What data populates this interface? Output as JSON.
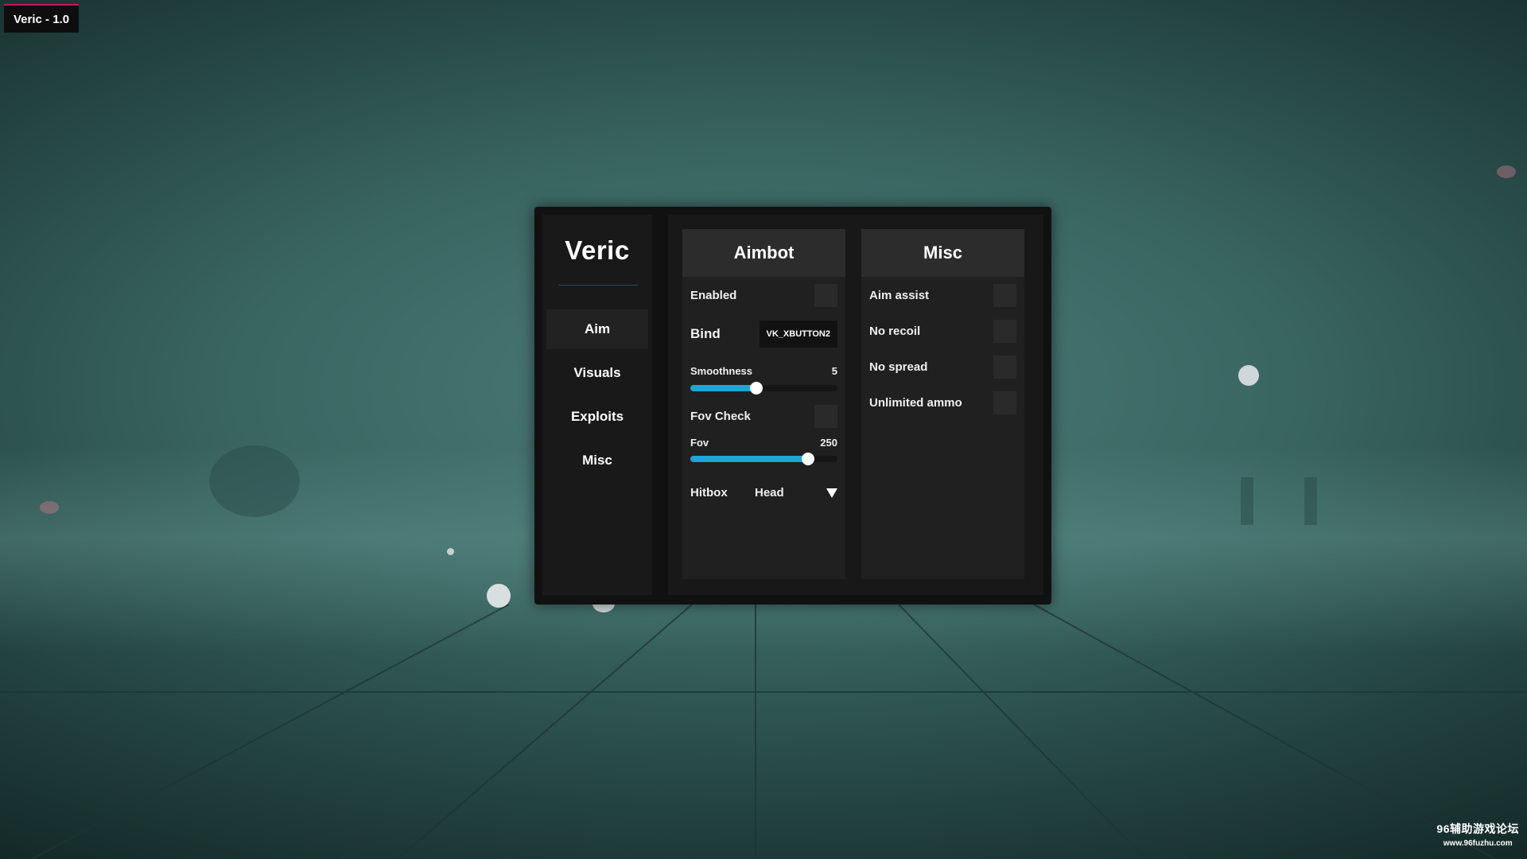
{
  "overlay": {
    "title": "Veric - 1.0"
  },
  "sidebar": {
    "brand": "Veric",
    "items": [
      {
        "label": "Aim",
        "active": true
      },
      {
        "label": "Visuals",
        "active": false
      },
      {
        "label": "Exploits",
        "active": false
      },
      {
        "label": "Misc",
        "active": false
      }
    ]
  },
  "aimbot": {
    "header": "Aimbot",
    "enabled_label": "Enabled",
    "enabled": false,
    "bind_label": "Bind",
    "bind_value": "VK_XBUTTON2",
    "smoothness_label": "Smoothness",
    "smoothness_value": "5",
    "smoothness_fraction": 0.45,
    "fov_check_label": "Fov Check",
    "fov_check": false,
    "fov_label": "Fov",
    "fov_value": "250",
    "fov_fraction": 0.8,
    "hitbox_label": "Hitbox",
    "hitbox_value": "Head"
  },
  "misc": {
    "header": "Misc",
    "items": [
      {
        "label": "Aim assist",
        "checked": false
      },
      {
        "label": "No recoil",
        "checked": false
      },
      {
        "label": "No spread",
        "checked": false
      },
      {
        "label": "Unlimited ammo",
        "checked": false
      }
    ]
  },
  "watermark": {
    "main": "96辅助游戏论坛",
    "sub": "www.96fuzhu.com"
  },
  "colors": {
    "accent": "#1ba6d6",
    "title_bar_accent": "#c2185b",
    "menu_background": "#111111"
  }
}
